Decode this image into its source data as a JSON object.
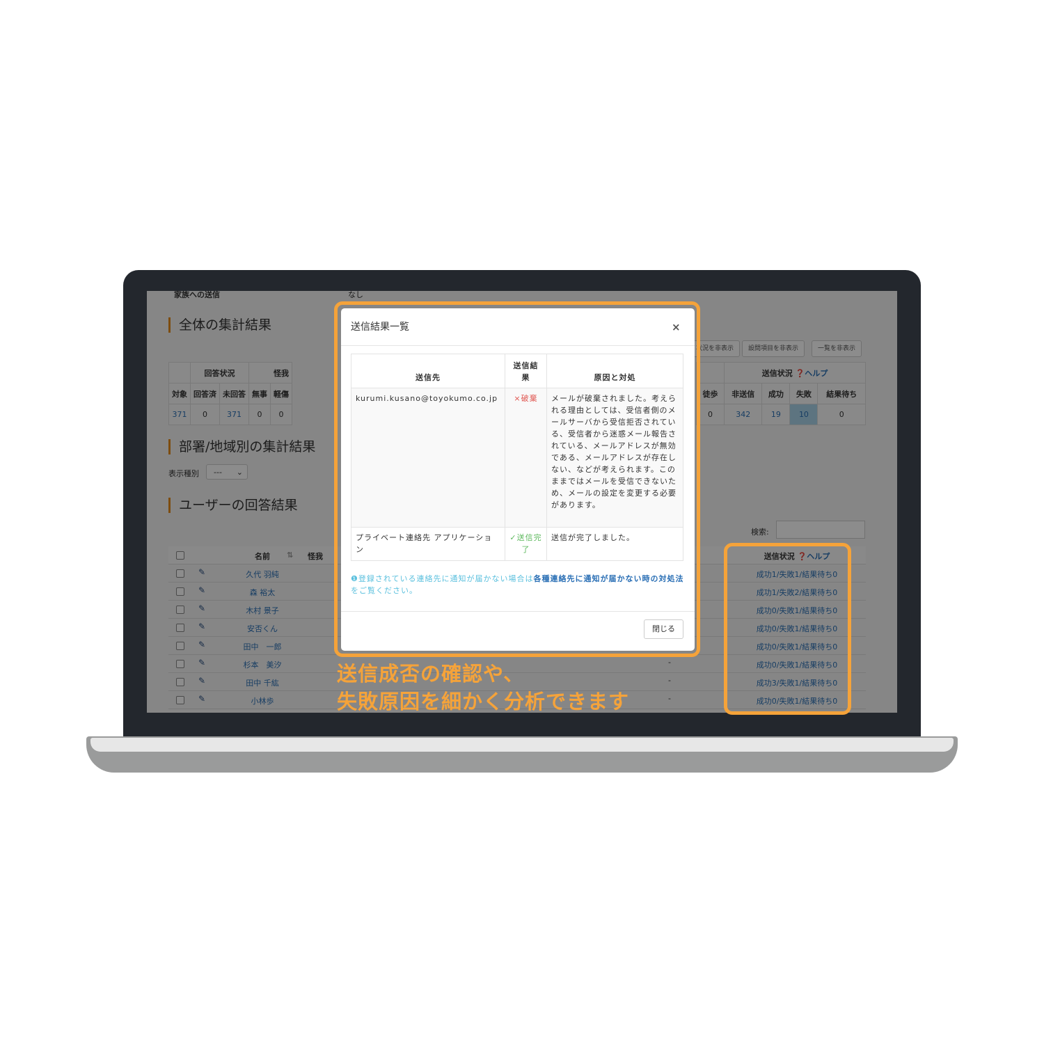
{
  "background_page": {
    "family_send_label": "家族への送信",
    "family_send_value": "なし",
    "overall_heading": "全体の集計結果",
    "dept_heading": "部署/地域別の集計結果",
    "display_type_label": "表示種別",
    "display_type_value": "---",
    "user_heading": "ユーザーの回答結果",
    "buttons": [
      "状況を非表示",
      "設問項目を非表示",
      "一覧を非表示"
    ],
    "summary": {
      "group_response": "回答状況",
      "group_injury": "怪我",
      "group_send": "送信状況",
      "help": "ヘルプ",
      "left_headers": [
        "対象",
        "回答済",
        "未回答",
        "無事",
        "軽傷"
      ],
      "left_values": [
        "371",
        "0",
        "371",
        "0",
        "0"
      ],
      "right_headers": [
        "徒歩",
        "非送信",
        "成功",
        "失敗",
        "結果待ち"
      ],
      "right_values": [
        "0",
        "342",
        "19",
        "10",
        "0"
      ]
    },
    "search_label": "検索:",
    "user_table": {
      "headers": {
        "name": "名前",
        "injury": "怪我",
        "send_status": "送信状況",
        "help": "ヘルプ"
      },
      "rows": [
        {
          "name": "久代 羽純",
          "status": "成功1/失敗1/結果待ち0",
          "cell": ""
        },
        {
          "name": "森 裕太",
          "status": "成功1/失敗2/結果待ち0",
          "cell": ""
        },
        {
          "name": "木村 景子",
          "status": "成功0/失敗1/結果待ち0",
          "cell": ""
        },
        {
          "name": "安否くん",
          "status": "成功0/失敗1/結果待ち0",
          "cell": ""
        },
        {
          "name": "田中　一郎",
          "status": "成功0/失敗1/結果待ち0",
          "cell": ""
        },
        {
          "name": "杉本　美汐",
          "status": "成功0/失敗1/結果待ち0",
          "cell": "-"
        },
        {
          "name": "田中 千紘",
          "status": "成功3/失敗1/結果待ち0",
          "cell": "-"
        },
        {
          "name": "小林歩",
          "status": "成功0/失敗1/結果待ち0",
          "cell": "-"
        }
      ]
    }
  },
  "modal": {
    "title": "送信結果一覧",
    "close_icon": "×",
    "headers": [
      "送信先",
      "送信結果",
      "原因と対処"
    ],
    "rows": [
      {
        "dest": "kurumi.kusano@toyokumo.co.jp",
        "result": "×破棄",
        "result_color": "#e0554f",
        "reason": "メールが破棄されました。考えられる理由としては、受信者側のメールサーバから受信拒否されている、受信者から迷惑メール報告されている、メールアドレスが無効である、メールアドレスが存在しない、などが考えられます。このままではメールを受信できないため、メールの設定を変更する必要があります。"
      },
      {
        "dest": "プライベート連絡先 アプリケーション",
        "result": "✓送信完了",
        "result_color": "#5cb85c",
        "reason": "送信が完了しました。"
      }
    ],
    "note_prefix": "登録されている連絡先に通知が届かない場合は",
    "note_link": "各種連絡先に通知が届かない時の対処法",
    "note_suffix": "をご覧ください。",
    "close_button": "閉じる"
  },
  "caption": {
    "line1": "送信成否の確認や、",
    "line2": "失敗原因を細かく分析できます"
  },
  "colors": {
    "accent": "#f5a33a",
    "link": "#2a6fb5",
    "bezel": "#23272d"
  }
}
